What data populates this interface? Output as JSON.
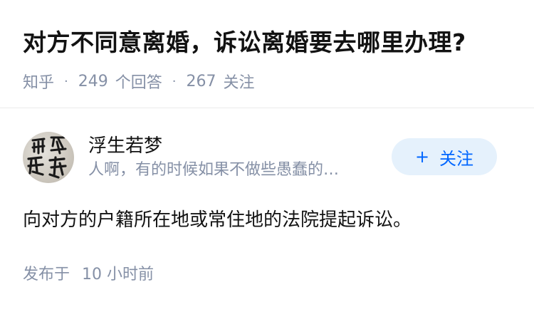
{
  "question": {
    "title": "对方不同意离婚，诉讼离婚要去哪里办理?",
    "source": "知乎",
    "answer_count": "249",
    "answer_label": "个回答",
    "follow_count": "267",
    "follow_label": "关注"
  },
  "answer": {
    "author_name": "浮生若梦",
    "author_bio": "人啊，有的时候如果不做些愚蠢的…",
    "follow_button_plus": "+",
    "follow_button_label": "关注",
    "content": "向对方的户籍所在地或常住地的法院提起诉讼。",
    "published_label": "发布于",
    "published_time": "10 小时前"
  },
  "colors": {
    "title_text": "#121212",
    "meta_text": "#8590a6",
    "accent": "#0066ff",
    "follow_bg": "#e5f1fc"
  },
  "icons": {
    "avatar": "calligraphy-avatar-image"
  }
}
